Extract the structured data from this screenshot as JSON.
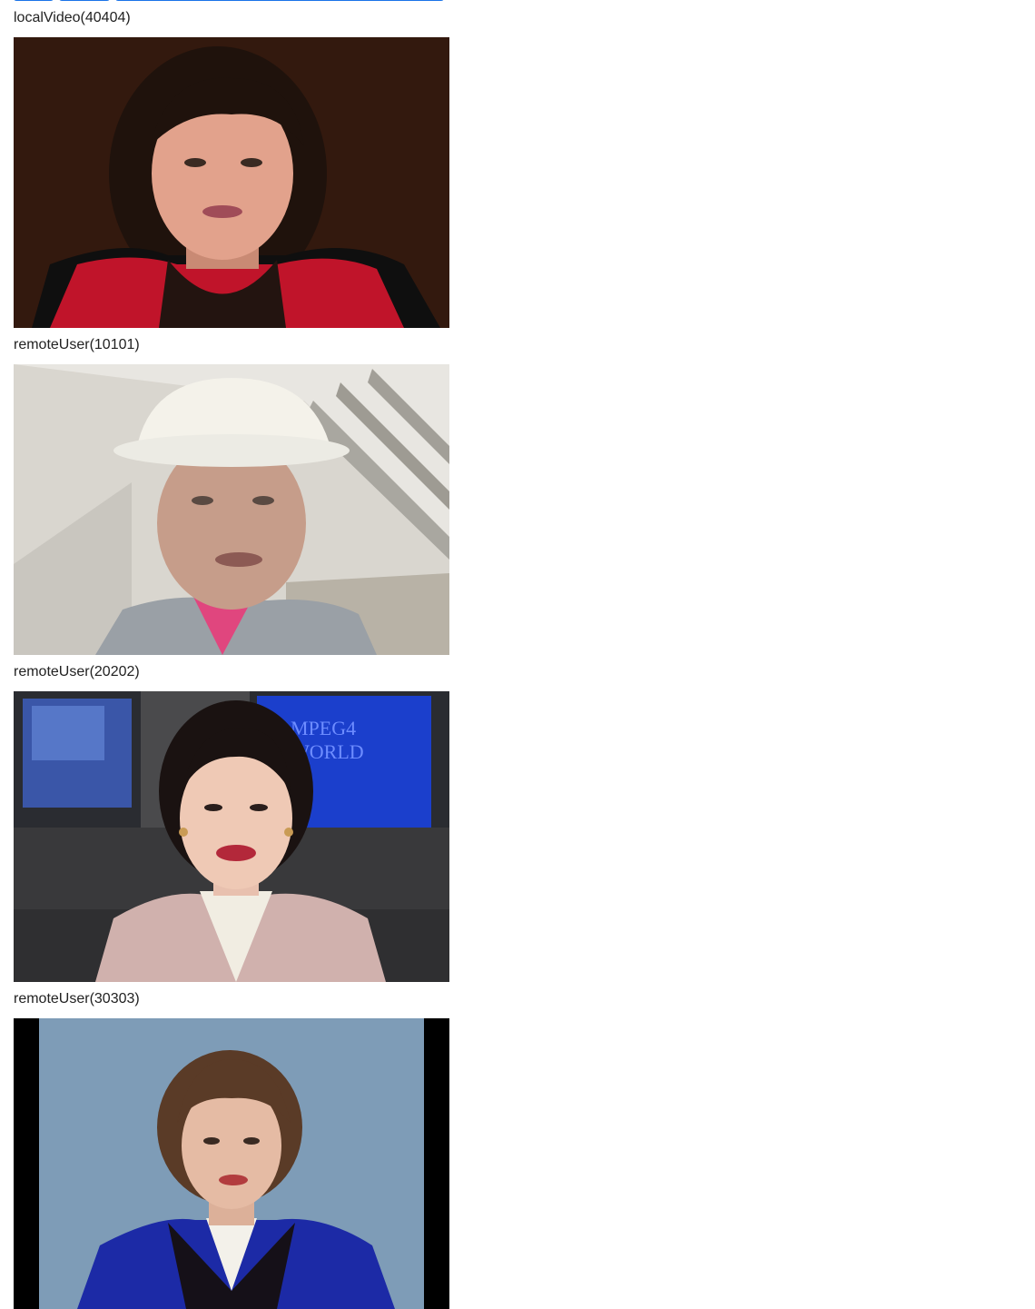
{
  "streams": [
    {
      "label": "localVideo(40404)",
      "thumbnail": "woman-red-top-dark-background"
    },
    {
      "label": "remoteUser(10101)",
      "thumbnail": "man-white-hardhat-concrete"
    },
    {
      "label": "remoteUser(20202)",
      "thumbnail": "news-anchor-pink-jacket"
    },
    {
      "label": "remoteUser(30303)",
      "thumbnail": "woman-blue-jacket-blue-background"
    }
  ],
  "overlay_text": {
    "monitor_line1": "MPEG4",
    "monitor_line2": "WORLD"
  },
  "colors": {
    "accent": "#1a73e8",
    "label_text": "#222222",
    "background": "#ffffff"
  }
}
